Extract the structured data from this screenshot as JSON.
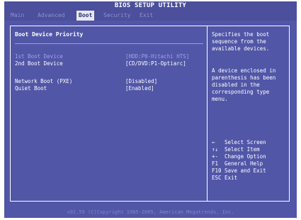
{
  "title": "BIOS SETUP UTILITY",
  "menu": {
    "items": [
      "Main",
      "Advanced",
      "Boot",
      "Security",
      "Exit"
    ],
    "active": "Boot"
  },
  "section_header": "Boot Device Priority",
  "boot_devices": [
    {
      "label": "1st Boot Device",
      "value": "[HDD:P0-Hitachi HTS]"
    },
    {
      "label": "2nd Boot Device",
      "value": "[CD/DVD:P1-Optiarc]"
    }
  ],
  "settings": [
    {
      "label": "Network Boot (PXE)",
      "value": "[Disabled]"
    },
    {
      "label": "Quiet Boot",
      "value": "[Enabled]"
    }
  ],
  "help": {
    "line1": "Specifies the boot\nsequence from the\navailable devices.",
    "line2": "A device enclosed in\nparenthesis has been\ndisabled in the\ncorresponding type\nmenu."
  },
  "keys": [
    {
      "key": "←",
      "desc": "Select Screen"
    },
    {
      "key": "↑↓",
      "desc": "Select Item"
    },
    {
      "key": "+-",
      "desc": "Change Option"
    },
    {
      "key": "F1",
      "desc": "General Help"
    },
    {
      "key": "F10",
      "desc": "Save and Exit"
    },
    {
      "key": "ESC",
      "desc": "Exit"
    }
  ],
  "footer": "v02.59 (C)Copyright 1985-2005, American Megatrends, Inc.",
  "colors": {
    "background": "#5156a7",
    "menu_bar": "#4b4f9c",
    "selected_text": "#9fa5e6",
    "text": "#ffffff"
  }
}
